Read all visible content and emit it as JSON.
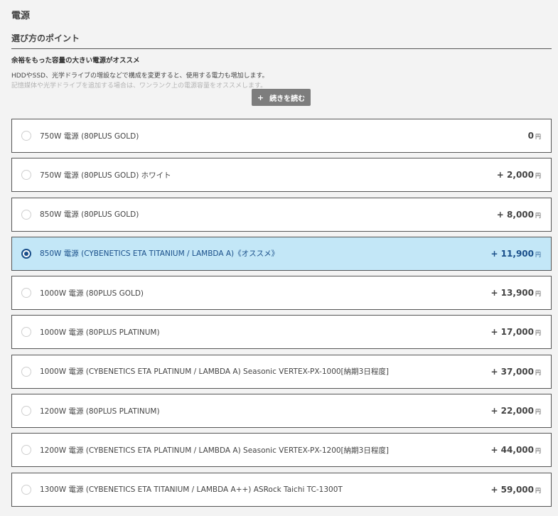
{
  "section": {
    "title": "電源"
  },
  "guide": {
    "title": "選び方のポイント",
    "subtitle": "余裕をもった容量の大きい電源がオススメ",
    "line1": "HDDやSSD、光学ドライブの増設などで構成を変更すると、使用する電力も増加します。",
    "line2": "記憶媒体や光学ドライブを追加する場合は、ワンランク上の電源容量をオススメします。",
    "read_more_icon": "+",
    "read_more_label": "続きを読む"
  },
  "options": [
    {
      "label": "750W 電源 (80PLUS GOLD)",
      "price": "0",
      "unit": "円",
      "selected": false
    },
    {
      "label": "750W 電源 (80PLUS GOLD) ホワイト",
      "price": "+ 2,000",
      "unit": "円",
      "selected": false
    },
    {
      "label": "850W 電源 (80PLUS GOLD)",
      "price": "+ 8,000",
      "unit": "円",
      "selected": false
    },
    {
      "label": "850W 電源 (CYBENETICS ETA TITANIUM / LAMBDA A)《オススメ》",
      "price": "+ 11,900",
      "unit": "円",
      "selected": true
    },
    {
      "label": "1000W 電源 (80PLUS GOLD)",
      "price": "+ 13,900",
      "unit": "円",
      "selected": false
    },
    {
      "label": "1000W 電源 (80PLUS PLATINUM)",
      "price": "+ 17,000",
      "unit": "円",
      "selected": false
    },
    {
      "label": "1000W 電源 (CYBENETICS ETA PLATINUM / LAMBDA A) Seasonic VERTEX-PX-1000[納期3日程度]",
      "price": "+ 37,000",
      "unit": "円",
      "selected": false
    },
    {
      "label": "1200W 電源 (80PLUS PLATINUM)",
      "price": "+ 22,000",
      "unit": "円",
      "selected": false
    },
    {
      "label": "1200W 電源 (CYBENETICS ETA PLATINUM / LAMBDA A) Seasonic VERTEX-PX-1200[納期3日程度]",
      "price": "+ 44,000",
      "unit": "円",
      "selected": false
    },
    {
      "label": "1300W 電源 (CYBENETICS ETA TITANIUM / LAMBDA A++) ASRock Taichi TC-1300T",
      "price": "+ 59,000",
      "unit": "円",
      "selected": false
    }
  ],
  "colors": {
    "selected_bg": "#c3e7f7",
    "selected_text": "#1a4f8a",
    "button_bg": "#7d7d7d"
  }
}
